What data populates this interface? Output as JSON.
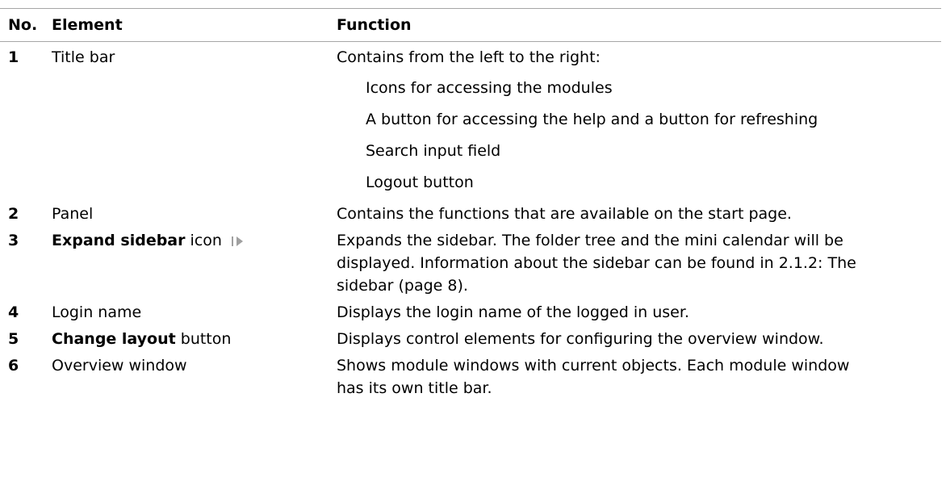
{
  "table": {
    "headers": {
      "no": "No.",
      "element": "Element",
      "function": "Function"
    },
    "rows": [
      {
        "no": "1",
        "element": "Title bar",
        "function": "Contains from the left to the right:",
        "items": [
          "Icons for accessing the modules",
          "A button for accessing the help and a button for refreshing",
          "Search input field",
          "Logout button"
        ]
      },
      {
        "no": "2",
        "element": "Panel",
        "function": "Contains the functions that are available on the start page."
      },
      {
        "no": "3",
        "element_bold": "Expand sidebar",
        "element_rest": " icon",
        "icon": "expand-sidebar-icon",
        "function_lines": [
          "Expands the sidebar. The folder tree and the mini calendar will be",
          "displayed. Information about the sidebar can be found in 2.1.2: The",
          "sidebar (page 8)."
        ]
      },
      {
        "no": "4",
        "element": "Login name",
        "function": "Displays the login name of the logged in user."
      },
      {
        "no": "5",
        "element_bold": "Change layout",
        "element_rest": " button",
        "function": "Displays control elements for configuring the overview window."
      },
      {
        "no": "6",
        "element": "Overview window",
        "function_lines": [
          "Shows module windows with current objects. Each module window",
          "has its own title bar."
        ]
      }
    ]
  }
}
